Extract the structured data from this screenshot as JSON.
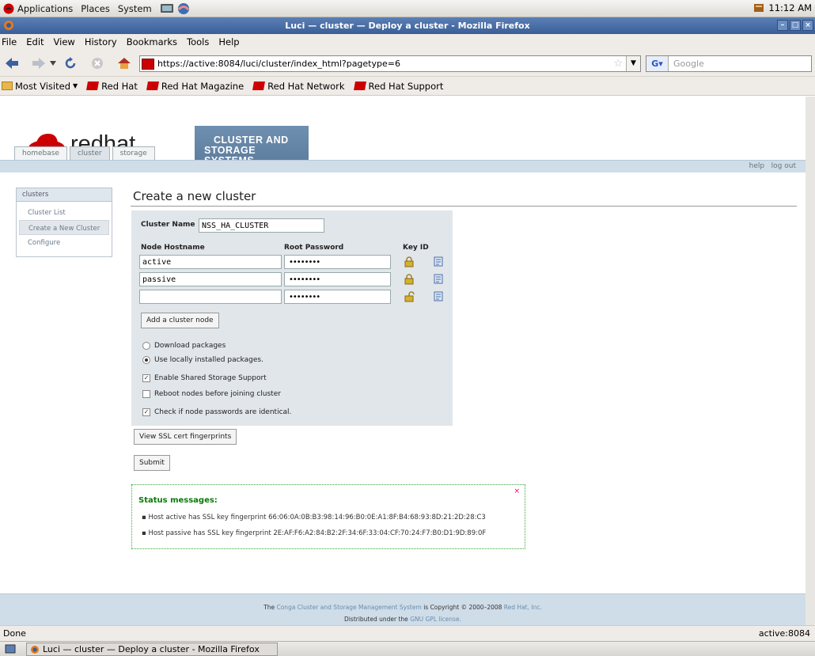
{
  "gnome_panel": {
    "menus": [
      "Applications",
      "Places",
      "System"
    ],
    "clock": "11:12 AM"
  },
  "window": {
    "title": "Luci — cluster — Deploy a cluster - Mozilla Firefox"
  },
  "menubar": {
    "items": [
      "File",
      "Edit",
      "View",
      "History",
      "Bookmarks",
      "Tools",
      "Help"
    ]
  },
  "navbar": {
    "url": "https://active:8084/luci/cluster/index_html?pagetype=6",
    "search_placeholder": "Google"
  },
  "bookmarks": {
    "items": [
      "Most Visited",
      "Red Hat",
      "Red Hat Magazine",
      "Red Hat Network",
      "Red Hat Support"
    ]
  },
  "header": {
    "brand": "redhat",
    "banner_line1": "CLUSTER AND",
    "banner_line2": "STORAGE SYSTEMS",
    "tabs": [
      "homebase",
      "cluster",
      "storage"
    ],
    "help": "help",
    "logout": "log out"
  },
  "sidebar": {
    "heading": "clusters",
    "items": [
      "Cluster List",
      "Create a New Cluster",
      "Configure"
    ]
  },
  "main": {
    "title": "Create a new cluster",
    "cluster_name_label": "Cluster Name",
    "cluster_name_value": "NSS_HA_CLUSTER",
    "col_hostname": "Node Hostname",
    "col_password": "Root Password",
    "col_keyid": "Key ID",
    "nodes": [
      {
        "hostname": "active",
        "password": "••••••••"
      },
      {
        "hostname": "passive",
        "password": "••••••••"
      },
      {
        "hostname": "",
        "password": "••••••••"
      }
    ],
    "add_node_button": "Add a cluster node",
    "opt_download": "Download packages",
    "opt_local": "Use locally installed packages.",
    "opt_shared": "Enable Shared Storage Support",
    "opt_reboot": "Reboot nodes before joining cluster",
    "opt_check_pw": "Check if node passwords are identical.",
    "ssl_button": "View SSL cert fingerprints",
    "submit_button": "Submit"
  },
  "status": {
    "title": "Status messages:",
    "close": "×",
    "messages": [
      "Host active has SSL key fingerprint 66:06:0A:0B:B3:98:14:96:B0:0E:A1:8F:B4:68:93:8D:21:2D:28:C3",
      "Host passive has SSL key fingerprint 2E:AF:F6:A2:84:B2:2F:34:6F:33:04:CF:70:24:F7:B0:D1:9D:89:0F"
    ]
  },
  "footer": {
    "t1": "The",
    "link1": "Conga Cluster and Storage Management System",
    "t2": "is Copyright © 2000–2008",
    "link2": "Red Hat, Inc.",
    "t3": "Distributed under the",
    "link3": "GNU GPL license."
  },
  "statusbar": {
    "left": "Done",
    "right": "active:8084"
  },
  "taskbar": {
    "window": "Luci — cluster — Deploy a cluster - Mozilla Firefox"
  }
}
